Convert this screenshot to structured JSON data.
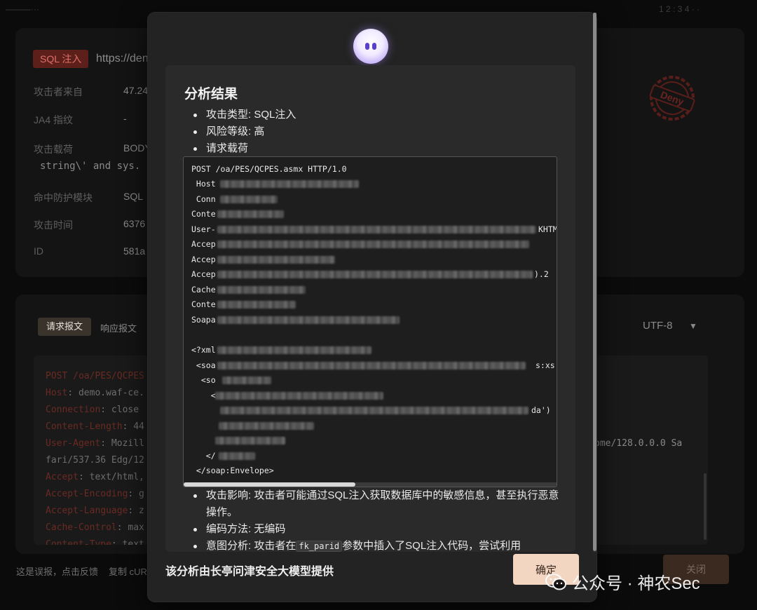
{
  "background": {
    "top_left": "———···",
    "top_right": "1 2 : 3 4 · ·",
    "tag": "SQL 注入",
    "url": "https://den",
    "rows": [
      {
        "label": "攻击者来自",
        "value": "47.24"
      },
      {
        "label": "JA4 指纹",
        "value": "-"
      },
      {
        "label": "攻击载荷",
        "value": "BODY"
      },
      {
        "label": "命中防护模块",
        "value": "SQL"
      },
      {
        "label": "攻击时间",
        "value": "6376"
      },
      {
        "label": "ID",
        "value": "581a"
      }
    ],
    "payload_fragment": "string\\' and sys.",
    "tabs": {
      "request": "请求报文",
      "response": "响应报文"
    },
    "encoding": "UTF-8",
    "code_lines": [
      {
        "key": "POST /oa/PES/QCPES",
        "rest": ""
      },
      {
        "key": "Host",
        "rest": ": demo.waf-ce."
      },
      {
        "key": "Connection",
        "rest": ": close"
      },
      {
        "key": "Content-Length",
        "rest": ": 44"
      },
      {
        "key": "User-Agent",
        "rest": ": Mozill"
      },
      {
        "key": "",
        "rest": "fari/537.36 Edg/12"
      },
      {
        "key": "Accept",
        "rest": ": text/html,"
      },
      {
        "key": "Accept-Encoding",
        "rest": ": g"
      },
      {
        "key": "Accept-Language",
        "rest": ": z"
      },
      {
        "key": "Cache-Control",
        "rest": ": max"
      },
      {
        "key": "Content-Type",
        "rest": ": text"
      }
    ],
    "right_text": "ome/128.0.0.0 Sa",
    "bottom_left": "这是误报，点击反馈",
    "bottom_copy": "复制 cUR",
    "close_label": "关闭",
    "seal_text": "Deny"
  },
  "modal": {
    "title": "分析结果",
    "bullets_top": [
      "攻击类型: SQL注入",
      "风险等级: 高",
      "请求载荷"
    ],
    "payload_lines": [
      "POST /oa/PES/QCPES.asmx HTTP/1.0",
      " Host",
      " Conn",
      "Conte",
      "User-",
      "Accep",
      "Accep",
      "Accep",
      "Cache",
      "Conte",
      "Soapa",
      "",
      "<?xml",
      " <soa",
      "  <so",
      "    <",
      "",
      "",
      "",
      "   </",
      " </soap:Envelope>"
    ],
    "payload_tails": {
      "user_agent": "KHTM",
      "accept_lang": ").2",
      "soap_ns": "s:xs",
      "param": "da')"
    },
    "impact_label": "攻击影响: 攻击者可能通过SQL注入获取数据库中的敏感信息，甚至执行恶意",
    "impact_cont": "操作。",
    "encoding_method": "编码方法: 无编码",
    "intent_prefix": "意图分析: 攻击者在",
    "intent_param": "fk_parid",
    "intent_suffix": "参数中插入了SQL注入代码，尝试利用",
    "footer": "该分析由长亭问津安全大模型提供",
    "confirm_label": "确定"
  },
  "watermark": "公众号 · 神农Sec"
}
